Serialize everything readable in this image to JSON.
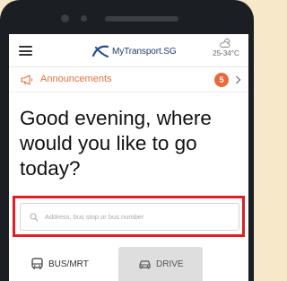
{
  "app": {
    "logo_text": "MyTransport.SG"
  },
  "weather": {
    "icon": "partly-cloudy-icon",
    "temperature": "25-34°C"
  },
  "announcements": {
    "label": "Announcements",
    "count": "5"
  },
  "greeting": {
    "text": "Good evening, where would you like to go today?"
  },
  "search": {
    "placeholder": "Address, bus stop or bus number"
  },
  "tabs": [
    {
      "label": "BUS/MRT",
      "icon": "bus-icon",
      "selected": true
    },
    {
      "label": "DRIVE",
      "icon": "car-icon",
      "selected": false
    }
  ],
  "colors": {
    "accent_orange": "#e2703d",
    "highlight_red": "#e01e22",
    "logo_blue": "#1f3b6b",
    "background": "#f6e8c8"
  }
}
